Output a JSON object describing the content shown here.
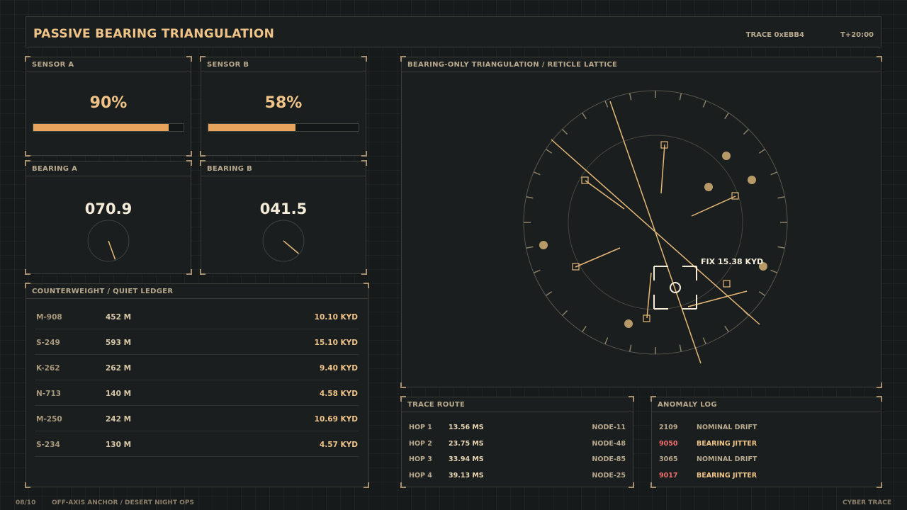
{
  "header": {
    "title": "PASSIVE BEARING TRIANGULATION",
    "trace_id": "TRACE 0xEBB4",
    "time": "T+20:00"
  },
  "sensors": [
    {
      "title": "SENSOR A",
      "value_text": "90%",
      "fill": 0.9
    },
    {
      "title": "SENSOR B",
      "value_text": "58%",
      "fill": 0.58
    }
  ],
  "bearings": [
    {
      "title": "BEARING A",
      "value_text": "070.9",
      "degrees": 160
    },
    {
      "title": "BEARING B",
      "value_text": "041.5",
      "degrees": 130
    }
  ],
  "ledger": {
    "title": "COUNTERWEIGHT / QUIET LEDGER",
    "rows": [
      {
        "id": "M-908",
        "dist": "452 M",
        "value": "10.10 KYD"
      },
      {
        "id": "S-249",
        "dist": "593 M",
        "value": "15.10 KYD"
      },
      {
        "id": "K-262",
        "dist": "262 M",
        "value": "9.40 KYD"
      },
      {
        "id": "N-713",
        "dist": "140 M",
        "value": "4.58 KYD"
      },
      {
        "id": "M-250",
        "dist": "242 M",
        "value": "10.69 KYD"
      },
      {
        "id": "S-234",
        "dist": "130 M",
        "value": "4.57 KYD"
      }
    ]
  },
  "scope": {
    "title": "BEARING-ONLY TRIANGULATION / RETICLE LATTICE",
    "fix_label": "FIX 15.38 KYD"
  },
  "trace_route": {
    "title": "TRACE ROUTE",
    "rows": [
      {
        "hop": "HOP 1",
        "ms": "13.56 MS",
        "node": "NODE-11"
      },
      {
        "hop": "HOP 2",
        "ms": "23.75 MS",
        "node": "NODE-48"
      },
      {
        "hop": "HOP 3",
        "ms": "33.94 MS",
        "node": "NODE-85"
      },
      {
        "hop": "HOP 4",
        "ms": "39.13 MS",
        "node": "NODE-25"
      }
    ]
  },
  "anomaly_log": {
    "title": "ANOMALY LOG",
    "rows": [
      {
        "code": "2109",
        "msg": "NOMINAL DRIFT",
        "alert": false
      },
      {
        "code": "9050",
        "msg": "BEARING JITTER",
        "alert": true
      },
      {
        "code": "3065",
        "msg": "NOMINAL DRIFT",
        "alert": false
      },
      {
        "code": "9017",
        "msg": "BEARING JITTER",
        "alert": true
      }
    ]
  },
  "footer": {
    "page": "08/10",
    "caption": "OFF-AXIS ANCHOR / DESERT NIGHT OPS",
    "brand": "CYBER TRACE"
  },
  "colors": {
    "accent": "#e6a45c",
    "accent_light": "#f0c488",
    "alert": "#f07070",
    "background": "#161a1a"
  }
}
